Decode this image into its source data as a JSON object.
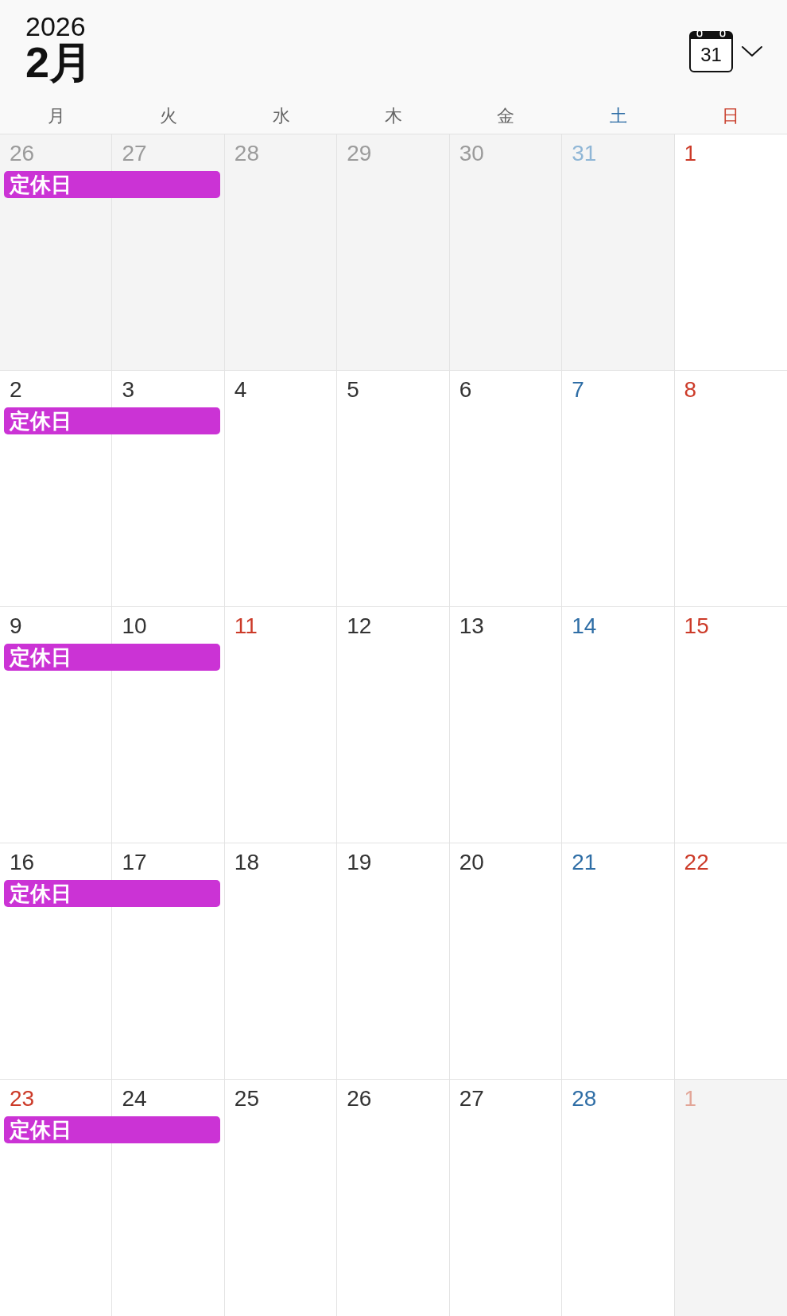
{
  "header": {
    "year": "2026",
    "month": "2月",
    "calendar_button": "31"
  },
  "weekdays": [
    {
      "label": "月",
      "kind": "weekday"
    },
    {
      "label": "火",
      "kind": "weekday"
    },
    {
      "label": "水",
      "kind": "weekday"
    },
    {
      "label": "木",
      "kind": "weekday"
    },
    {
      "label": "金",
      "kind": "weekday"
    },
    {
      "label": "土",
      "kind": "saturday"
    },
    {
      "label": "日",
      "kind": "sunday"
    }
  ],
  "weeks": [
    {
      "event": {
        "title": "定休日"
      },
      "days": [
        {
          "date": "26",
          "kind": "weekday",
          "other_month": true,
          "in_event": true
        },
        {
          "date": "27",
          "kind": "weekday",
          "other_month": true,
          "in_event": true
        },
        {
          "date": "28",
          "kind": "weekday",
          "other_month": true,
          "in_event": false
        },
        {
          "date": "29",
          "kind": "weekday",
          "other_month": true,
          "in_event": false
        },
        {
          "date": "30",
          "kind": "weekday",
          "other_month": true,
          "in_event": false
        },
        {
          "date": "31",
          "kind": "saturday",
          "other_month": true,
          "in_event": false
        },
        {
          "date": "1",
          "kind": "sunday",
          "other_month": false,
          "in_event": false
        }
      ]
    },
    {
      "event": {
        "title": "定休日"
      },
      "days": [
        {
          "date": "2",
          "kind": "weekday",
          "other_month": false,
          "in_event": true
        },
        {
          "date": "3",
          "kind": "weekday",
          "other_month": false,
          "in_event": true
        },
        {
          "date": "4",
          "kind": "weekday",
          "other_month": false,
          "in_event": false
        },
        {
          "date": "5",
          "kind": "weekday",
          "other_month": false,
          "in_event": false
        },
        {
          "date": "6",
          "kind": "weekday",
          "other_month": false,
          "in_event": false
        },
        {
          "date": "7",
          "kind": "saturday",
          "other_month": false,
          "in_event": false
        },
        {
          "date": "8",
          "kind": "sunday",
          "other_month": false,
          "in_event": false
        }
      ]
    },
    {
      "event": {
        "title": "定休日"
      },
      "days": [
        {
          "date": "9",
          "kind": "weekday",
          "other_month": false,
          "in_event": true
        },
        {
          "date": "10",
          "kind": "weekday",
          "other_month": false,
          "in_event": true
        },
        {
          "date": "11",
          "kind": "holiday",
          "other_month": false,
          "in_event": false
        },
        {
          "date": "12",
          "kind": "weekday",
          "other_month": false,
          "in_event": false
        },
        {
          "date": "13",
          "kind": "weekday",
          "other_month": false,
          "in_event": false
        },
        {
          "date": "14",
          "kind": "saturday",
          "other_month": false,
          "in_event": false
        },
        {
          "date": "15",
          "kind": "sunday",
          "other_month": false,
          "in_event": false
        }
      ]
    },
    {
      "event": {
        "title": "定休日"
      },
      "days": [
        {
          "date": "16",
          "kind": "weekday",
          "other_month": false,
          "in_event": true
        },
        {
          "date": "17",
          "kind": "weekday",
          "other_month": false,
          "in_event": true
        },
        {
          "date": "18",
          "kind": "weekday",
          "other_month": false,
          "in_event": false
        },
        {
          "date": "19",
          "kind": "weekday",
          "other_month": false,
          "in_event": false
        },
        {
          "date": "20",
          "kind": "weekday",
          "other_month": false,
          "in_event": false
        },
        {
          "date": "21",
          "kind": "saturday",
          "other_month": false,
          "in_event": false
        },
        {
          "date": "22",
          "kind": "sunday",
          "other_month": false,
          "in_event": false
        }
      ]
    },
    {
      "event": {
        "title": "定休日"
      },
      "days": [
        {
          "date": "23",
          "kind": "holiday",
          "other_month": false,
          "in_event": true
        },
        {
          "date": "24",
          "kind": "weekday",
          "other_month": false,
          "in_event": true
        },
        {
          "date": "25",
          "kind": "weekday",
          "other_month": false,
          "in_event": false
        },
        {
          "date": "26",
          "kind": "weekday",
          "other_month": false,
          "in_event": false
        },
        {
          "date": "27",
          "kind": "weekday",
          "other_month": false,
          "in_event": false
        },
        {
          "date": "28",
          "kind": "saturday",
          "other_month": false,
          "in_event": false
        },
        {
          "date": "1",
          "kind": "sunday",
          "other_month": true,
          "in_event": false
        }
      ]
    }
  ]
}
